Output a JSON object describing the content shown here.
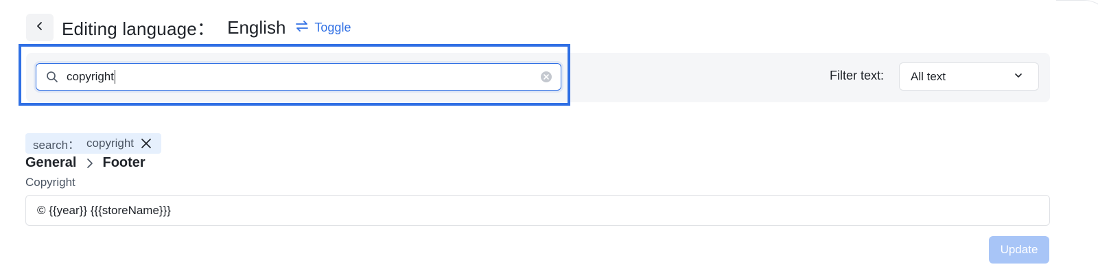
{
  "header": {
    "title": "Editing language：",
    "language": "English",
    "toggle_label": "Toggle"
  },
  "search": {
    "value": "copyright",
    "placeholder": ""
  },
  "filter": {
    "label": "Filter text:",
    "selected": "All text"
  },
  "search_tag": {
    "key": "search：",
    "value": "copyright"
  },
  "breadcrumb": {
    "items": [
      "General",
      "Footer"
    ]
  },
  "field": {
    "label": "Copyright",
    "value": "© {{year}} {{{storeName}}}"
  },
  "actions": {
    "update_label": "Update"
  },
  "colors": {
    "accent": "#2f6fe4",
    "highlight_border": "#2f6fe4",
    "tag_background": "#e6f0fd",
    "button_disabled": "#a8c5f7"
  },
  "icons": {
    "back": "chevron-left-icon",
    "toggle": "swap-arrows-icon",
    "search": "search-icon",
    "clear": "clear-circle-icon",
    "dropdown": "chevron-down-icon",
    "tag_close": "close-icon",
    "breadcrumb_separator": "chevron-right-icon"
  }
}
